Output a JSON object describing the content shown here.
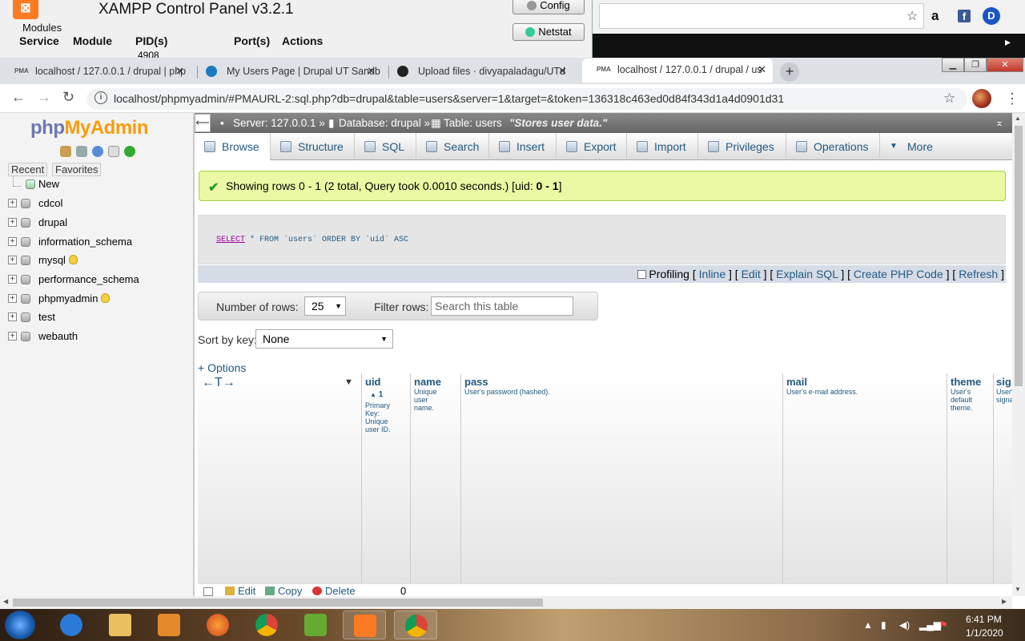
{
  "xampp": {
    "logo": "⊠",
    "title": "XAMPP Control Panel v3.2.1",
    "modules_label": "Modules",
    "headers": [
      "Service",
      "Module",
      "PID(s)",
      "Port(s)",
      "Actions"
    ],
    "pid": "4908",
    "config_label": "Config",
    "netstat_label": "Netstat"
  },
  "tabs": [
    {
      "title": "localhost / 127.0.0.1 / drupal | php",
      "favicon": "PMA"
    },
    {
      "title": "My Users Page | Drupal UT Sandb",
      "favicon": "drupal-icon"
    },
    {
      "title": "Upload files · divyapaladagu/UTd",
      "favicon": "github-icon"
    },
    {
      "title": "localhost / 127.0.0.1 / drupal / us",
      "favicon": "PMA"
    }
  ],
  "browser": {
    "url": "localhost/phpmyadmin/#PMAURL-2:sql.php?db=drupal&table=users&server=1&target=&token=136318c463ed0d84f343d1a4d0901d31"
  },
  "pma": {
    "logo_php": "php",
    "logo_myadmin": "MyAdmin",
    "left_tabs": [
      "Recent",
      "Favorites"
    ],
    "new_label": "New",
    "databases": [
      {
        "name": "cdcol",
        "bulb": false
      },
      {
        "name": "drupal",
        "bulb": false
      },
      {
        "name": "information_schema",
        "bulb": false
      },
      {
        "name": "mysql",
        "bulb": true
      },
      {
        "name": "performance_schema",
        "bulb": false
      },
      {
        "name": "phpmyadmin",
        "bulb": true
      },
      {
        "name": "test",
        "bulb": false
      },
      {
        "name": "webauth",
        "bulb": false
      }
    ],
    "breadcrumb": {
      "server": "Server: 127.0.0.1 »",
      "database": "Database: drupal »",
      "table": "Table: users",
      "comment": "\"Stores user data.\""
    },
    "tabs": [
      "Browse",
      "Structure",
      "SQL",
      "Search",
      "Insert",
      "Export",
      "Import",
      "Privileges",
      "Operations",
      "More"
    ],
    "success_msg": "Showing rows 0 - 1 (2 total, Query took 0.0010 seconds.) [uid: ",
    "success_range": "0 - 1",
    "success_end": "]",
    "sql": {
      "select": "SELECT",
      "rest": " * FROM `users` ORDER BY `uid` ASC"
    },
    "sql_links": {
      "profiling": "Profiling",
      "inline": "Inline",
      "edit": "Edit",
      "explain": "Explain SQL",
      "create_php": "Create PHP Code",
      "refresh": "Refresh"
    },
    "nav": {
      "rows_label": "Number of rows:",
      "rows_value": "25",
      "filter_label": "Filter rows:",
      "filter_placeholder": "Search this table"
    },
    "sort": {
      "label": "Sort by key:",
      "value": "None"
    },
    "options_link": "+ Options",
    "columns": [
      {
        "name": "uid",
        "desc": "Primary Key: Unique user ID.",
        "sort": "1"
      },
      {
        "name": "name",
        "desc": "Unique user name."
      },
      {
        "name": "pass",
        "desc": "User's password (hashed)."
      },
      {
        "name": "mail",
        "desc": "User's e-mail address."
      },
      {
        "name": "theme",
        "desc": "User's default theme."
      },
      {
        "name": "sig",
        "desc": "User's signa"
      }
    ],
    "row": {
      "edit": "Edit",
      "copy": "Copy",
      "delete": "Delete",
      "uid": "0"
    }
  },
  "taskbar": {
    "time": "6:41 PM",
    "date": "1/1/2020"
  }
}
